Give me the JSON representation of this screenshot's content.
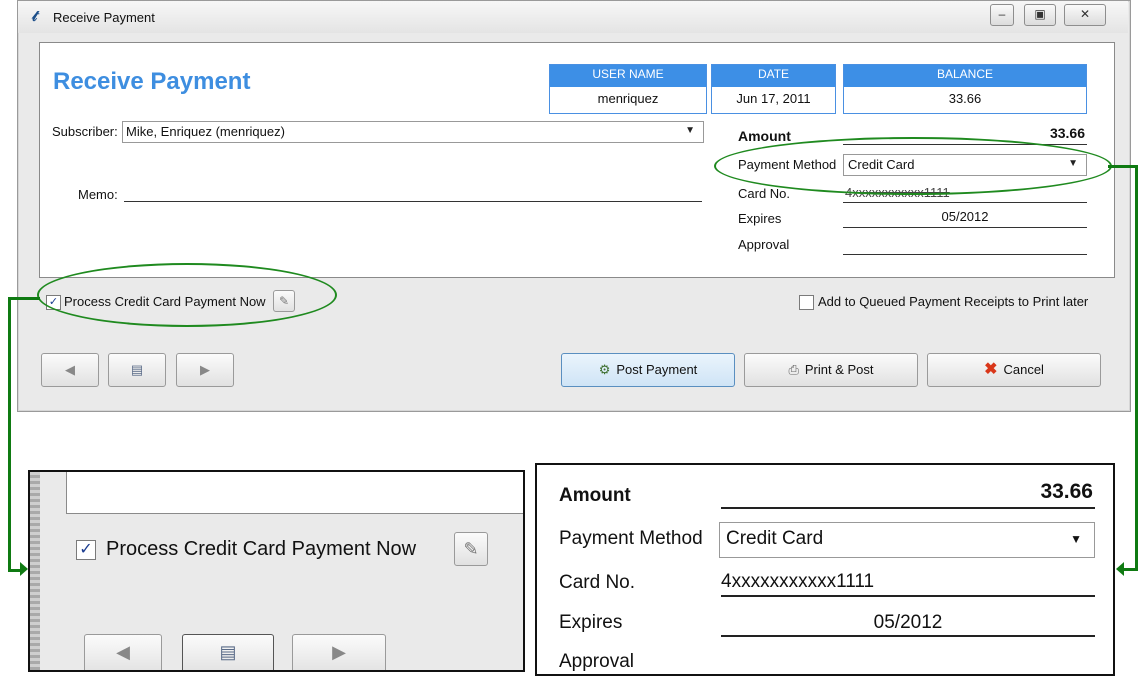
{
  "window": {
    "title": "Receive Payment",
    "minimize_icon": "minimize-icon",
    "maximize_icon": "maximize-icon",
    "close_icon": "close-icon"
  },
  "form": {
    "page_title": "Receive Payment",
    "header": {
      "user_name_label": "USER NAME",
      "user_name_value": "menriquez",
      "date_label": "DATE",
      "date_value": "Jun 17, 2011",
      "balance_label": "BALANCE",
      "balance_value": "33.66"
    },
    "subscriber_label": "Subscriber:",
    "subscriber_value": "Mike, Enriquez (menriquez)",
    "memo_label": "Memo:",
    "memo_value": "",
    "amount_label": "Amount",
    "amount_value": "33.66",
    "payment_method_label": "Payment Method",
    "payment_method_value": "Credit Card",
    "card_no_label": "Card No.",
    "card_no_value": "4xxxxxxxxxxx1111",
    "expires_label": "Expires",
    "expires_value": "05/2012",
    "approval_label": "Approval",
    "approval_value": ""
  },
  "options": {
    "process_cc_label": "Process Credit Card Payment Now",
    "process_cc_checked": true,
    "queued_label": "Add to Queued Payment Receipts to Print later",
    "queued_checked": false
  },
  "buttons": {
    "post_payment": "Post Payment",
    "print_post": "Print & Post",
    "cancel": "Cancel"
  },
  "zoom_left": {
    "process_cc_label": "Process Credit Card Payment Now"
  },
  "zoom_right": {
    "amount_label": "Amount",
    "amount_value": "33.66",
    "payment_method_label": "Payment Method",
    "payment_method_value": "Credit Card",
    "card_no_label": "Card No.",
    "card_no_value": "4xxxxxxxxxxx1111",
    "expires_label": "Expires",
    "expires_value": "05/2012",
    "approval_label": "Approval"
  },
  "colors": {
    "accent": "#3d8fe6",
    "title": "#3e8ee0",
    "callout": "#1f8a1f",
    "cancel": "#d9371a"
  }
}
